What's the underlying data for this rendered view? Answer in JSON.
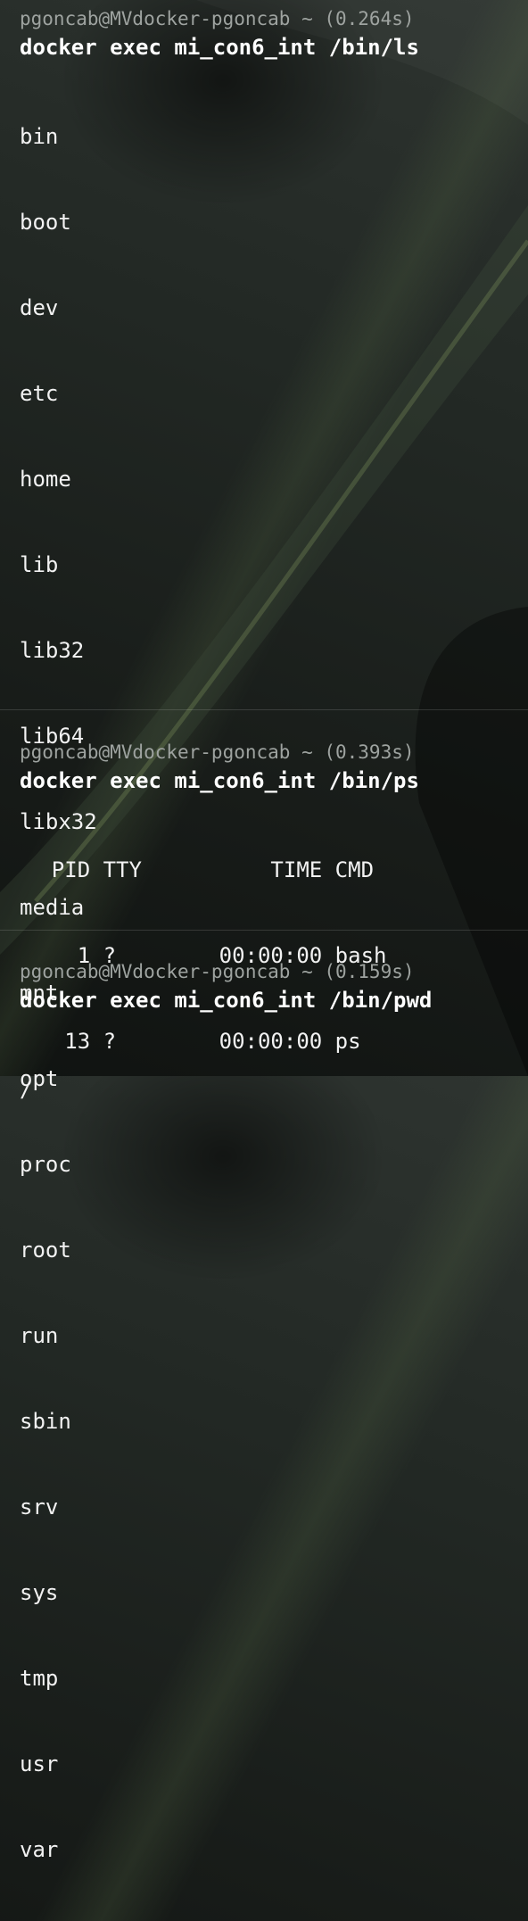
{
  "blocks": [
    {
      "prompt": "pgoncab@MVdocker-pgoncab ~ (0.264s)",
      "command": "docker exec mi_con6_int /bin/ls",
      "output": [
        "bin",
        "boot",
        "dev",
        "etc",
        "home",
        "lib",
        "lib32",
        "lib64",
        "libx32",
        "media",
        "mnt",
        "opt",
        "proc",
        "root",
        "run",
        "sbin",
        "srv",
        "sys",
        "tmp",
        "usr",
        "var"
      ]
    },
    {
      "prompt": "pgoncab@MVdocker-pgoncab ~ (0.393s)",
      "command": "docker exec mi_con6_int /bin/ps",
      "output": [
        "    PID TTY          TIME CMD",
        "      1 ?        00:00:00 bash",
        "     13 ?        00:00:00 ps"
      ]
    },
    {
      "prompt": "pgoncab@MVdocker-pgoncab ~ (0.159s)",
      "command": "docker exec mi_con6_int /bin/pwd",
      "output": [
        "/"
      ]
    }
  ]
}
